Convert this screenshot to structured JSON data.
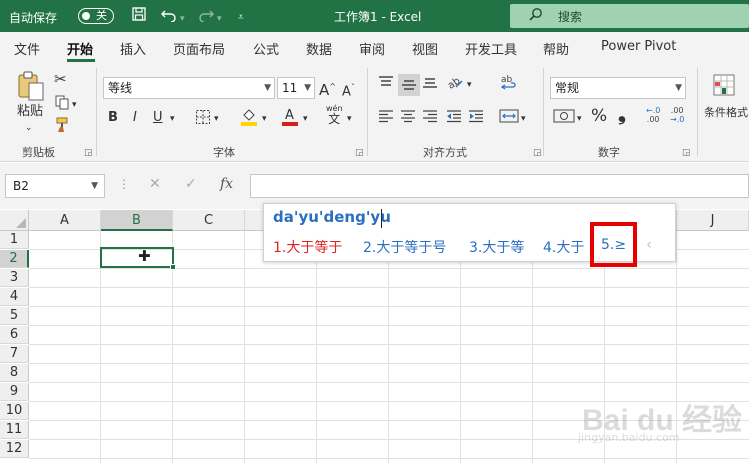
{
  "titlebar": {
    "autosave_label": "自动保存",
    "autosave_state": "关",
    "save_icon": "save-icon",
    "undo_icon": "undo-icon",
    "redo_icon": "redo-icon",
    "customize_icon": "customize-qat-icon",
    "title": "工作簿1  -  Excel",
    "search_label": "搜索",
    "accent": "#217346"
  },
  "tabs": [
    "文件",
    "开始",
    "插入",
    "页面布局",
    "公式",
    "数据",
    "审阅",
    "视图",
    "开发工具",
    "帮助",
    "Power Pivot"
  ],
  "active_tab": "开始",
  "ribbon": {
    "clipboard": {
      "paste_label": "粘贴",
      "group_label": "剪贴板"
    },
    "font": {
      "font_name": "等线",
      "font_size": "11",
      "bold": "B",
      "italic": "I",
      "underline": "U",
      "font_color": "#d42020",
      "fill_color": "#ffd400",
      "phonetic": "wén",
      "phonetic_char": "文",
      "group_label": "字体"
    },
    "alignment": {
      "wrap_glyph": "ab",
      "group_label": "对齐方式"
    },
    "number": {
      "format": "常规",
      "currency": "¥",
      "percent": "%",
      "comma": "⁾",
      "inc_decimal": "←.0\n.00",
      "dec_decimal": ".00\n→.0",
      "group_label": "数字"
    },
    "styles": {
      "conditional_label": "条件格式"
    }
  },
  "formula_bar": {
    "name_box": "B2",
    "cancel_icon": "✕",
    "enter_icon": "✓",
    "fx_label": "fx",
    "formula": ""
  },
  "grid": {
    "columns": [
      "A",
      "B",
      "C",
      "D",
      "E",
      "F",
      "G",
      "H",
      "I",
      "J"
    ],
    "rows": [
      "1",
      "2",
      "3",
      "4",
      "5",
      "6",
      "7",
      "8",
      "9",
      "10",
      "11",
      "12"
    ],
    "selected_column": "B",
    "selected_row": "2",
    "active_cell": "B2"
  },
  "ime": {
    "composition": "da'yu'deng'yu",
    "candidates": [
      "1.大于等于",
      "2.大于等于号",
      "3.大于等",
      "4.大于",
      "5.≥"
    ],
    "more_glyph": ">",
    "prev_glyph": "‹"
  },
  "watermark": {
    "logo": "Bai du 经验",
    "url": "jingyan.baidu.com"
  }
}
